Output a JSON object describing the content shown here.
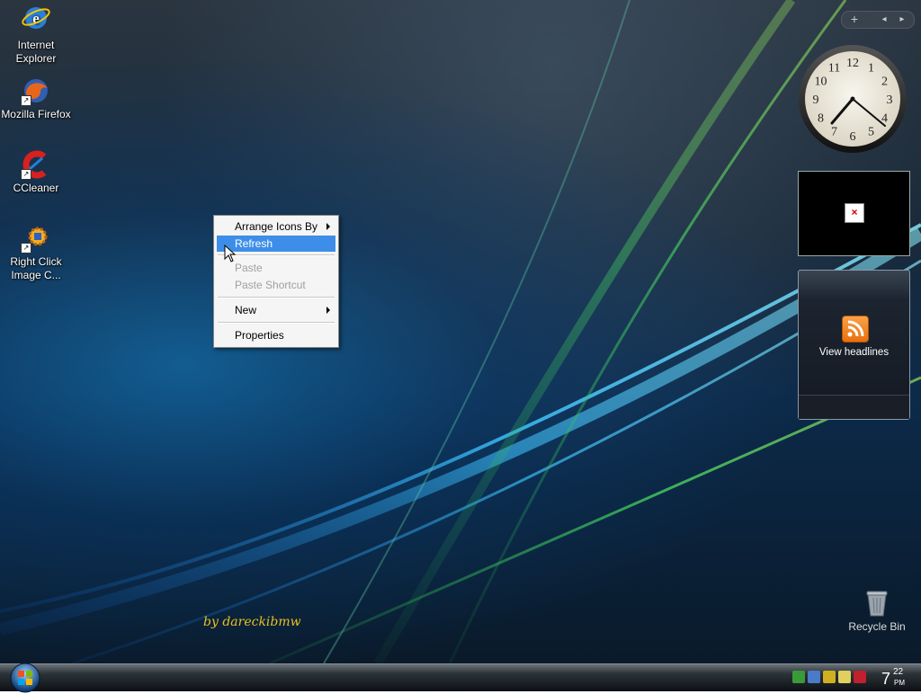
{
  "desktop_icons": [
    {
      "label": "Internet Explorer",
      "icon": "internet-explorer-icon"
    },
    {
      "label": "Mozilla Firefox",
      "icon": "firefox-icon"
    },
    {
      "label": "CCleaner",
      "icon": "ccleaner-icon"
    },
    {
      "label": "Right Click Image C...",
      "icon": "right-click-image-converter-icon"
    }
  ],
  "context_menu": {
    "items": [
      {
        "label": "Arrange Icons By",
        "submenu": true,
        "state": "normal"
      },
      {
        "label": "Refresh",
        "submenu": false,
        "state": "highlighted"
      },
      {
        "label": "Paste",
        "submenu": false,
        "state": "disabled"
      },
      {
        "label": "Paste Shortcut",
        "submenu": false,
        "state": "disabled"
      },
      {
        "label": "New",
        "submenu": true,
        "state": "normal"
      },
      {
        "label": "Properties",
        "submenu": false,
        "state": "normal"
      }
    ]
  },
  "sidebar": {
    "controls": {
      "add": "+",
      "prev": "◂",
      "next": "▸"
    },
    "clock": {
      "hours": [
        "12",
        "1",
        "2",
        "3",
        "4",
        "5",
        "6",
        "7",
        "8",
        "9",
        "10",
        "11"
      ],
      "time": "7:22"
    },
    "picture_gadget": {
      "broken_symbol": "×"
    },
    "feed_gadget": {
      "label": "View headlines"
    }
  },
  "signature": "by dareckibmw",
  "recycle_bin": {
    "label": "Recycle Bin"
  },
  "taskbar": {
    "clock": {
      "hour": "7",
      "minute": "22",
      "ampm": "PM"
    },
    "tray_icons": [
      "network-icon",
      "display-icon",
      "power-icon",
      "wand-icon",
      "security-shield-icon"
    ]
  },
  "colors": {
    "menu_highlight": "#3d8ee8",
    "signature": "#e8c020",
    "feed_orange": "#f39020"
  }
}
